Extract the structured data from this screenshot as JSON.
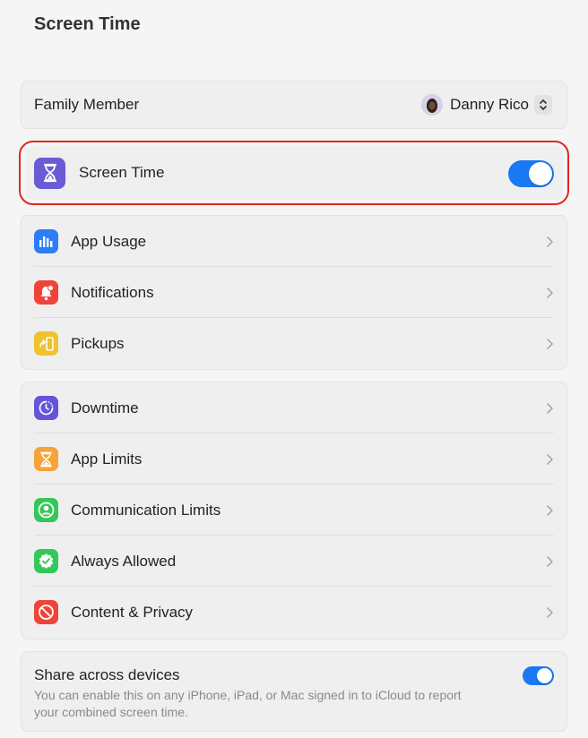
{
  "page": {
    "title": "Screen Time"
  },
  "family": {
    "label": "Family Member",
    "member_name": "Danny Rico"
  },
  "screen_time": {
    "label": "Screen Time",
    "enabled": true
  },
  "usage": {
    "items": [
      {
        "label": "App Usage",
        "icon": "bar-chart-icon"
      },
      {
        "label": "Notifications",
        "icon": "bell-icon"
      },
      {
        "label": "Pickups",
        "icon": "pickup-phone-icon"
      }
    ]
  },
  "limits": {
    "items": [
      {
        "label": "Downtime",
        "icon": "downtime-icon"
      },
      {
        "label": "App Limits",
        "icon": "hourglass-icon"
      },
      {
        "label": "Communication Limits",
        "icon": "person-circle-icon"
      },
      {
        "label": "Always Allowed",
        "icon": "checkmark-badge-icon"
      },
      {
        "label": "Content & Privacy",
        "icon": "no-entry-icon"
      }
    ]
  },
  "share": {
    "title": "Share across devices",
    "description_line1": "You can enable this on any iPhone, iPad, or Mac signed in to iCloud to report",
    "description_line2": "your combined screen time.",
    "enabled": true
  },
  "colors": {
    "accent": "#1a78f2",
    "highlight_ring": "#e0271f",
    "screen_time_icon": "#6a5bd6",
    "app_usage_icon": "#2d7df6",
    "notifications_icon": "#f0443b",
    "pickups_icon": "#f1c22f",
    "downtime_icon": "#6456d8",
    "app_limits_icon": "#f7a23a",
    "communication_icon": "#35c759",
    "always_allowed_icon": "#34c759",
    "content_privacy_icon": "#f0443b"
  }
}
